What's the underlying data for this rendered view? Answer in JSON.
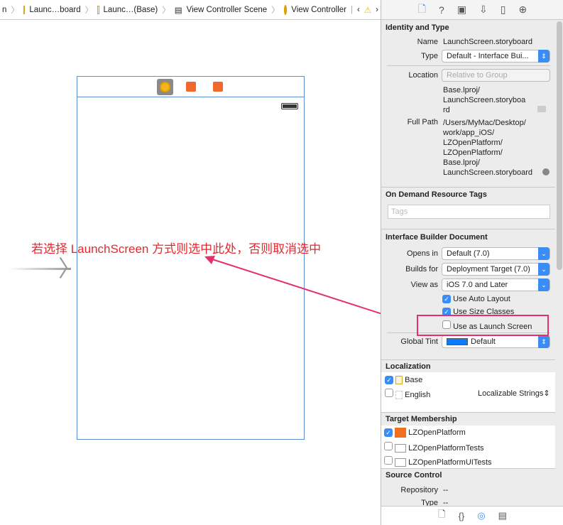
{
  "jumpbar": {
    "items": [
      "n",
      "Launc…board",
      "Launc…(Base)",
      "View Controller Scene",
      "View Controller"
    ]
  },
  "annotation": {
    "text": "若选择 LaunchScreen 方式则选中此处，否则取消选中",
    "color": "#e8262d"
  },
  "inspector": {
    "identity": {
      "title": "Identity and Type",
      "name_label": "Name",
      "name": "LaunchScreen.storyboard",
      "type_label": "Type",
      "type": "Default - Interface Bui...",
      "location_label": "Location",
      "location": "Relative to Group",
      "relpath": [
        "Base.lproj/",
        "LaunchScreen.storyboa",
        "rd"
      ],
      "fullpath_label": "Full Path",
      "fullpath": [
        "/Users/MyMac/Desktop/",
        "work/app_iOS/",
        "LZOpenPlatform/",
        "LZOpenPlatform/",
        "Base.lproj/",
        "LaunchScreen.storyboard"
      ]
    },
    "tags": {
      "title": "On Demand Resource Tags",
      "placeholder": "Tags"
    },
    "ibdoc": {
      "title": "Interface Builder Document",
      "opens_label": "Opens in",
      "opens": "Default (7.0)",
      "builds_label": "Builds for",
      "builds": "Deployment Target (7.0)",
      "view_label": "View as",
      "view": "iOS 7.0 and Later",
      "auto_layout": "Use Auto Layout",
      "size_classes": "Use Size Classes",
      "launch": "Use as Launch Screen",
      "tint_label": "Global Tint",
      "tint": "Default",
      "tint_color": "#0a7aff"
    },
    "localization": {
      "title": "Localization",
      "items": [
        {
          "label": "Base",
          "checked": true
        },
        {
          "label": "English",
          "checked": false,
          "type": "Localizable Strings"
        }
      ]
    },
    "target": {
      "title": "Target Membership",
      "items": [
        {
          "label": "LZOpenPlatform",
          "checked": true
        },
        {
          "label": "LZOpenPlatformTests",
          "checked": false
        },
        {
          "label": "LZOpenPlatformUITests",
          "checked": false
        }
      ]
    },
    "source": {
      "title": "Source Control",
      "repo_label": "Repository",
      "repo": "--",
      "type_label": "Type",
      "type": "--"
    }
  }
}
